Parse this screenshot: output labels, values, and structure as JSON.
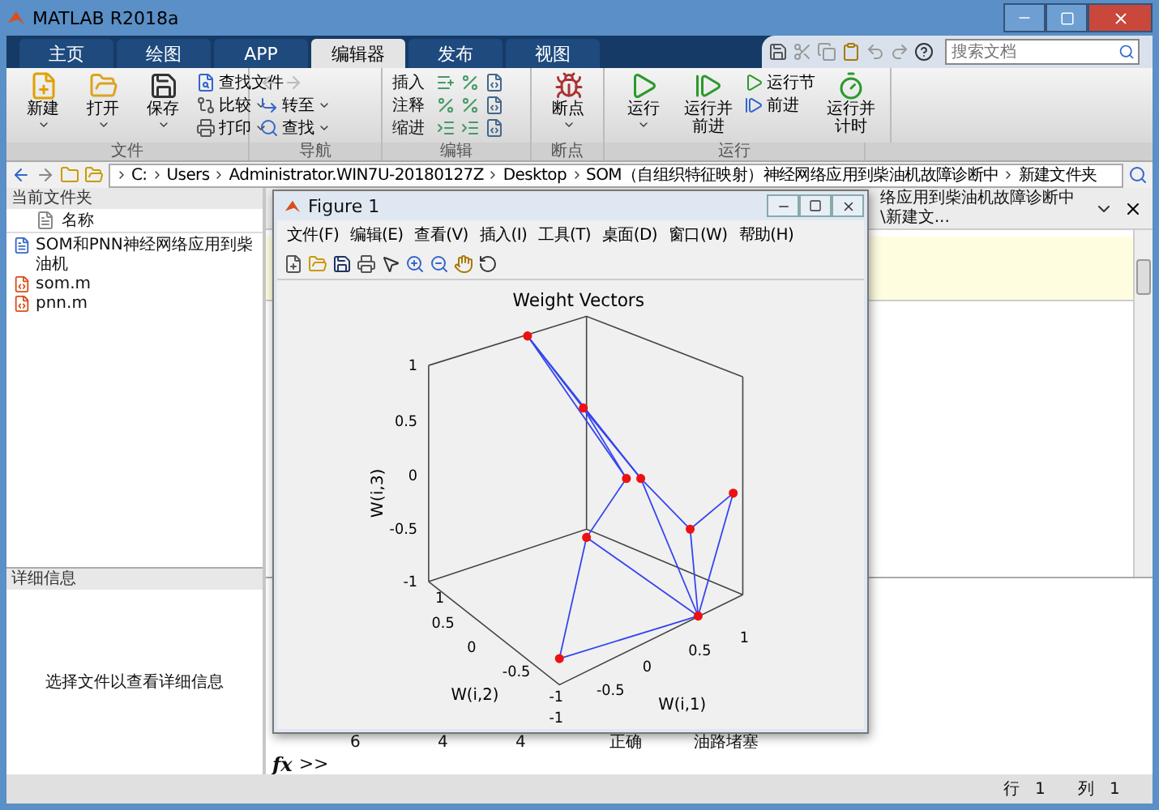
{
  "window": {
    "title": "MATLAB R2018a"
  },
  "tabs": [
    {
      "label": "主页",
      "selected": false
    },
    {
      "label": "绘图",
      "selected": false
    },
    {
      "label": "APP",
      "selected": false
    },
    {
      "label": "编辑器",
      "selected": true
    },
    {
      "label": "发布",
      "selected": false
    },
    {
      "label": "视图",
      "selected": false
    }
  ],
  "search": {
    "placeholder": "搜索文档"
  },
  "ribbon": [
    {
      "label": "文件",
      "items": [
        {
          "kind": "large",
          "label": "新建",
          "dropdown": true
        },
        {
          "kind": "large",
          "label": "打开",
          "dropdown": true
        },
        {
          "kind": "large",
          "label": "保存",
          "dropdown": true
        },
        {
          "kind": "small",
          "label": "查找文件",
          "dropdown": false
        },
        {
          "kind": "small",
          "label": "比较",
          "dropdown": true
        },
        {
          "kind": "small",
          "label": "打印",
          "dropdown": true
        }
      ]
    },
    {
      "label": "导航",
      "items": [
        {
          "kind": "arrows",
          "disabled": true
        },
        {
          "kind": "small",
          "label": "转至",
          "dropdown": true
        },
        {
          "kind": "small",
          "label": "查找",
          "dropdown": true
        }
      ]
    },
    {
      "label": "编辑",
      "items": [
        {
          "kind": "row",
          "label": "插入"
        },
        {
          "kind": "row",
          "label": "注释"
        },
        {
          "kind": "row",
          "label": "缩进"
        }
      ]
    },
    {
      "label": "断点",
      "items": [
        {
          "kind": "large",
          "label": "断点",
          "dropdown": true
        }
      ]
    },
    {
      "label": "运行",
      "items": [
        {
          "kind": "large",
          "label": "运行",
          "dropdown": true
        },
        {
          "kind": "large",
          "label": "运行并前进",
          "dropdown": false
        },
        {
          "kind": "small",
          "label": "运行节",
          "dropdown": false
        },
        {
          "kind": "small",
          "label": "前进",
          "dropdown": false
        },
        {
          "kind": "large",
          "label": "运行并计时",
          "dropdown": false
        }
      ]
    }
  ],
  "address": [
    "C:",
    "Users",
    "Administrator.WIN7U-20180127Z",
    "Desktop",
    "SOM（自组织特征映射）神经网络应用到柴油机故障诊断中",
    "新建文件夹"
  ],
  "current_folder": {
    "title": "当前文件夹",
    "column": "名称",
    "files": [
      {
        "name": "SOM和PNN神经网络应用到柴油机",
        "kind": "document"
      },
      {
        "name": "som.m",
        "kind": "mfile"
      },
      {
        "name": "pnn.m",
        "kind": "mfile"
      }
    ]
  },
  "details": {
    "title": "详细信息",
    "message": "选择文件以查看详细信息"
  },
  "editor": {
    "path": "络应用到柴油机故障诊断中\\新建文..."
  },
  "command_window": {
    "output": [
      "6",
      "4",
      "4",
      "正确",
      "油路堵塞"
    ],
    "fx": "fx",
    "prompt": ">>"
  },
  "figure": {
    "title": "Figure 1",
    "menus": [
      "文件(F)",
      "编辑(E)",
      "查看(V)",
      "插入(I)",
      "工具(T)",
      "桌面(D)",
      "窗口(W)",
      "帮助(H)"
    ],
    "plot": {
      "title": "Weight Vectors",
      "zlabel": "W(i,3)",
      "ylabel": "W(i,2)",
      "xlabel": "W(i,1)",
      "zticks": [
        "1",
        "0.5",
        "0",
        "-0.5",
        "-1"
      ],
      "yticks": [
        "1",
        "0.5",
        "0",
        "-0.5",
        "-1"
      ],
      "xticks": [
        "-1",
        "-0.5",
        "0",
        "0.5",
        "1"
      ]
    }
  },
  "status": [
    {
      "label": "行",
      "value": "1"
    },
    {
      "label": "列",
      "value": "1"
    }
  ]
}
